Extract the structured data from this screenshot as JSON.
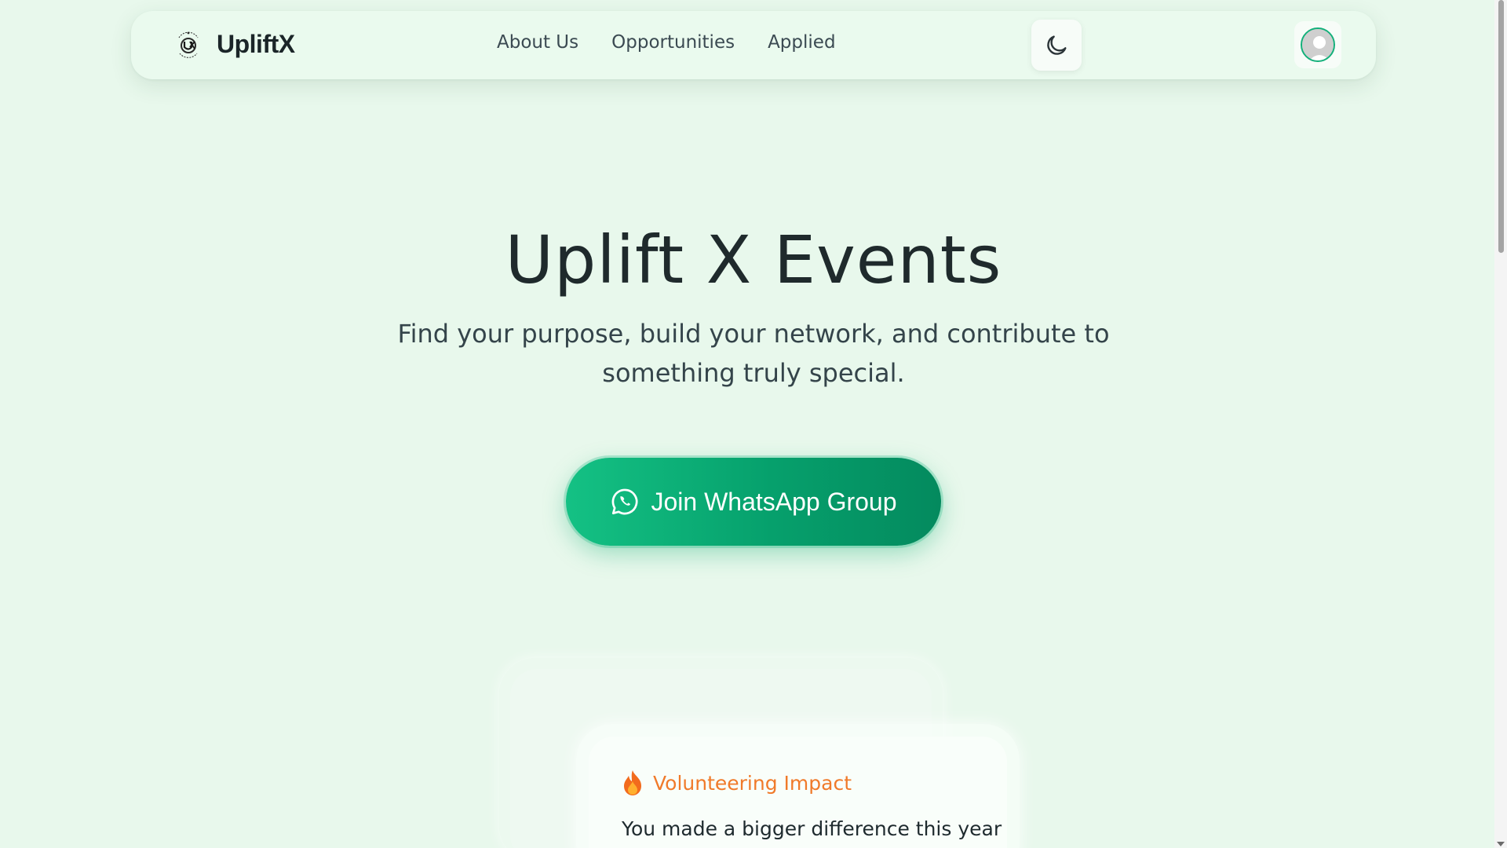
{
  "navbar": {
    "brand_name": "UpliftX",
    "links": [
      {
        "label": "About Us"
      },
      {
        "label": "Opportunities"
      },
      {
        "label": "Applied"
      }
    ],
    "theme_toggle_icon": "moon-icon",
    "avatar_icon": "user-avatar-icon"
  },
  "hero": {
    "title": "Uplift X Events",
    "subtitle": "Find your purpose, build your network, and contribute to something truly special.",
    "cta_label": "Join WhatsApp Group",
    "cta_icon": "whatsapp-icon"
  },
  "impact_card": {
    "icon": "flame-icon",
    "label": "Volunteering Impact",
    "text": "You made a bigger difference this year"
  },
  "colors": {
    "background": "#e8f8ec",
    "accent_green": "#0aa872",
    "impact_orange": "#f07a2a"
  }
}
